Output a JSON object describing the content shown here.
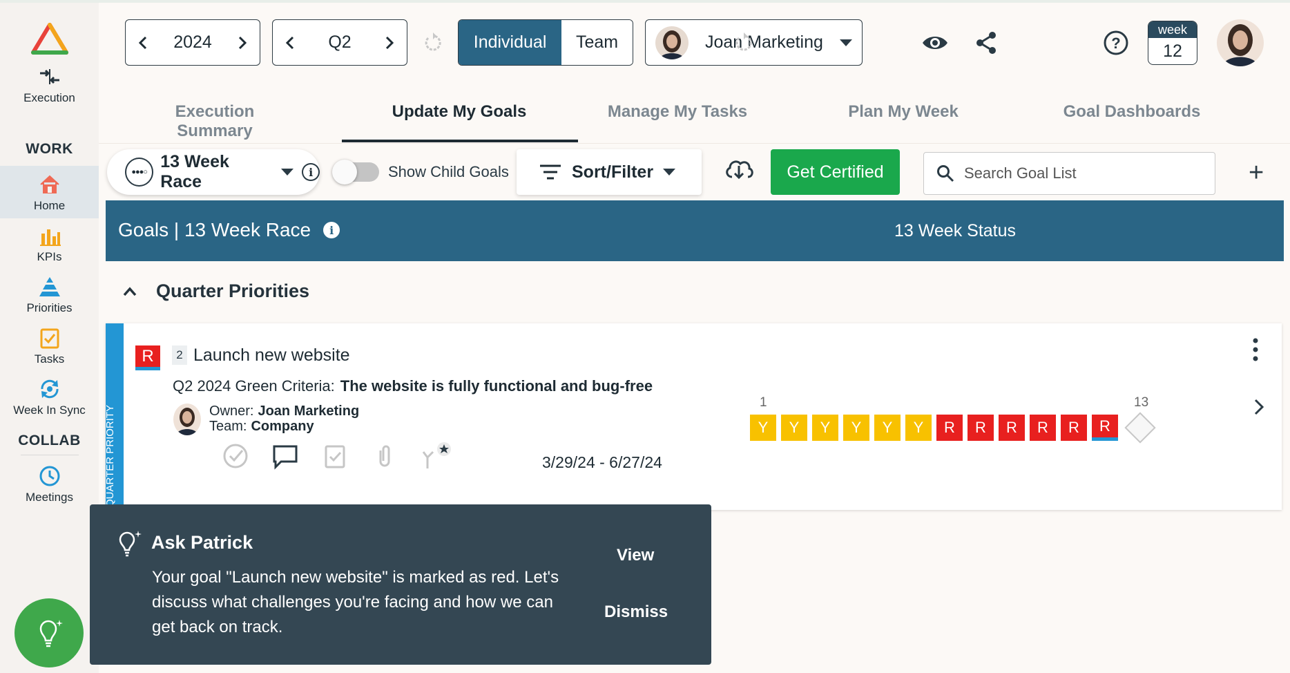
{
  "header": {
    "year": "2024",
    "quarter": "Q2",
    "view_individual": "Individual",
    "view_team": "Team",
    "user_name": "Joan Marketing",
    "week_label": "week",
    "week_number": "12"
  },
  "sidebar": {
    "execution": "Execution",
    "work_label": "WORK",
    "items": [
      {
        "label": "Home"
      },
      {
        "label": "KPIs"
      },
      {
        "label": "Priorities"
      },
      {
        "label": "Tasks"
      },
      {
        "label": "Week In Sync"
      }
    ],
    "collab_label": "COLLAB",
    "meetings": "Meetings"
  },
  "tabs": [
    {
      "label": "Execution Summary"
    },
    {
      "label": "Update My Goals"
    },
    {
      "label": "Manage My Tasks"
    },
    {
      "label": "Plan My Week"
    },
    {
      "label": "Goal Dashboards"
    }
  ],
  "toolbar": {
    "race": "13 Week Race",
    "show_child_goals": "Show Child Goals",
    "sort_filter": "Sort/Filter",
    "get_certified": "Get Certified",
    "search_placeholder": "Search Goal List"
  },
  "band": {
    "title": "Goals | 13 Week Race",
    "status": "13 Week Status"
  },
  "section": {
    "title": "Quarter Priorities"
  },
  "goal": {
    "status": "R",
    "number": "2",
    "title": "Launch new website",
    "criteria_label": "Q2 2024 Green Criteria:",
    "criteria_value": "The website is fully functional and bug-free",
    "owner_label": "Owner:",
    "owner_value": "Joan Marketing",
    "team_label": "Team:",
    "team_value": "Company",
    "dates": "3/29/24 - 6/27/24",
    "strip_label": "QUARTER PRIORITY",
    "week_start_label": "1",
    "week_end_label": "13",
    "weeks": [
      "Y",
      "Y",
      "Y",
      "Y",
      "Y",
      "Y",
      "R",
      "R",
      "R",
      "R",
      "R",
      "R"
    ]
  },
  "toast": {
    "title": "Ask Patrick",
    "message": "Your goal \"Launch new website\" is marked as red. Let's discuss what challenges you're facing and how we can get back on track.",
    "view": "View",
    "dismiss": "Dismiss"
  },
  "colors": {
    "primary": "#2a6585",
    "green": "#1aa84c",
    "red": "#e8201f",
    "yellow": "#f8c100",
    "strip_blue": "#2396d4",
    "toast_bg": "#344753"
  }
}
